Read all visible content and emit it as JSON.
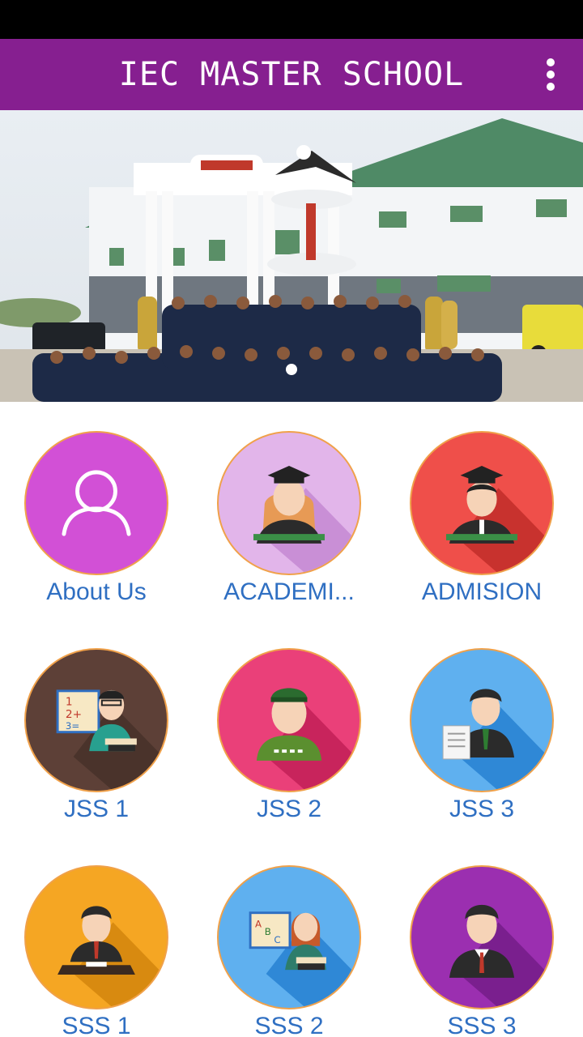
{
  "app_bar": {
    "title": "IEC MASTER SCHOOL",
    "menu_icon": "more-vert-icon"
  },
  "banner": {
    "image": "school-building-students-photo",
    "indicator_count": 1
  },
  "menu": [
    {
      "label": "About Us",
      "icon": "person-outline-icon",
      "color": "#d250d6"
    },
    {
      "label": "ACADEMI...",
      "icon": "graduate-girl-icon",
      "color": "#e2b5ea"
    },
    {
      "label": "ADMISION",
      "icon": "graduate-boy-icon",
      "color": "#ef4f4a"
    },
    {
      "label": "JSS 1",
      "icon": "math-teacher-icon",
      "color": "#5d4037"
    },
    {
      "label": "JSS 2",
      "icon": "student-cap-icon",
      "color": "#ea4079"
    },
    {
      "label": "JSS 3",
      "icon": "student-paper-icon",
      "color": "#5fb0ef"
    },
    {
      "label": "SSS 1",
      "icon": "student-desk-icon",
      "color": "#f5a623"
    },
    {
      "label": "SSS 2",
      "icon": "abc-teacher-icon",
      "color": "#5fb0ef"
    },
    {
      "label": "SSS 3",
      "icon": "student-suit-icon",
      "color": "#9b2fb0"
    }
  ]
}
